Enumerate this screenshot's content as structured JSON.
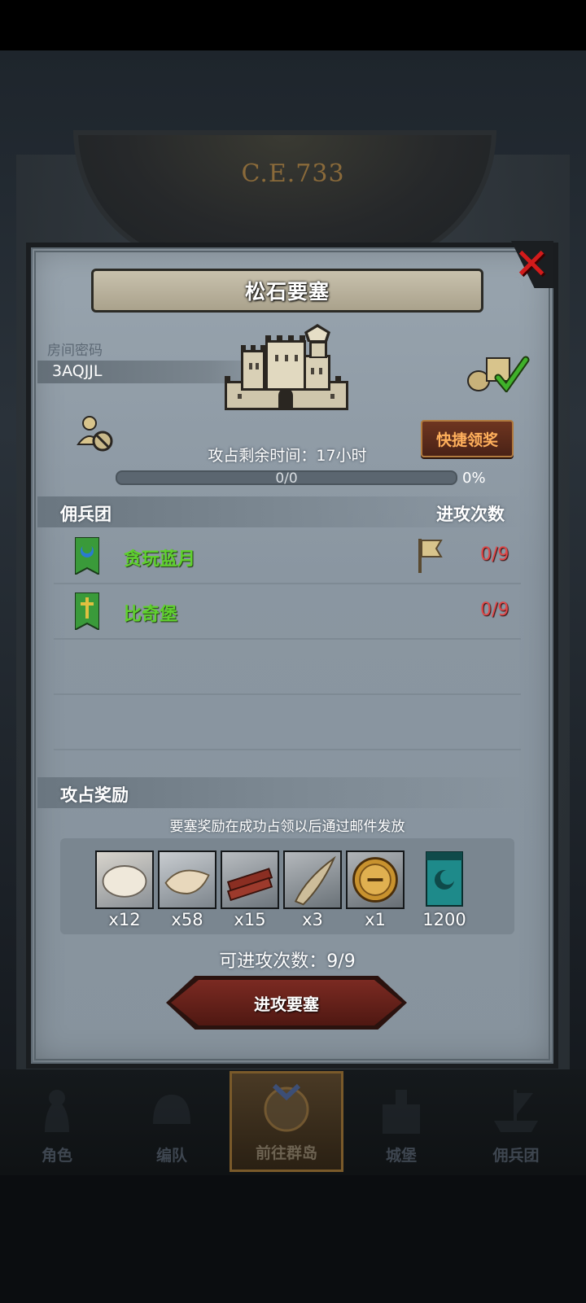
{
  "scene": {
    "era": "C.E.733"
  },
  "dialog": {
    "title": "松石要塞",
    "room_label": "房间密码",
    "room_code": "3AQJJL",
    "quick_claim": "快捷领奖",
    "time_remaining": "攻占剩余时间：17小时",
    "progress_text": "0/0",
    "progress_pct": "0%",
    "progress_value": 0
  },
  "mercenaries": {
    "header_left": "佣兵团",
    "header_right": "进攻次数",
    "rows": [
      {
        "name": "贪玩蓝月",
        "count": "0/9"
      },
      {
        "name": "比奇堡",
        "count": "0/9"
      }
    ]
  },
  "rewards": {
    "header": "攻占奖励",
    "note": "要塞奖励在成功占领以后通过邮件发放",
    "items": [
      {
        "icon": "fur-icon",
        "count": "x12"
      },
      {
        "icon": "hide-icon",
        "count": "x58"
      },
      {
        "icon": "wood-icon",
        "count": "x15"
      },
      {
        "icon": "horn-icon",
        "count": "x3"
      },
      {
        "icon": "gold-helmet-coin-icon",
        "count": "x1"
      },
      {
        "icon": "guild-banner-icon",
        "count": "1200"
      }
    ]
  },
  "attack": {
    "attempts": "可进攻次数：9/9",
    "button": "进攻要塞"
  },
  "nav": {
    "items": [
      {
        "label": "角色"
      },
      {
        "label": "编队"
      },
      {
        "label": "前往群岛"
      },
      {
        "label": "城堡"
      },
      {
        "label": "佣兵团"
      }
    ]
  },
  "colors": {
    "merc_name": "#5fd02e",
    "count_red": "#e04848",
    "quick_btn_text": "#ffb05c",
    "close": "#d21b1b"
  }
}
